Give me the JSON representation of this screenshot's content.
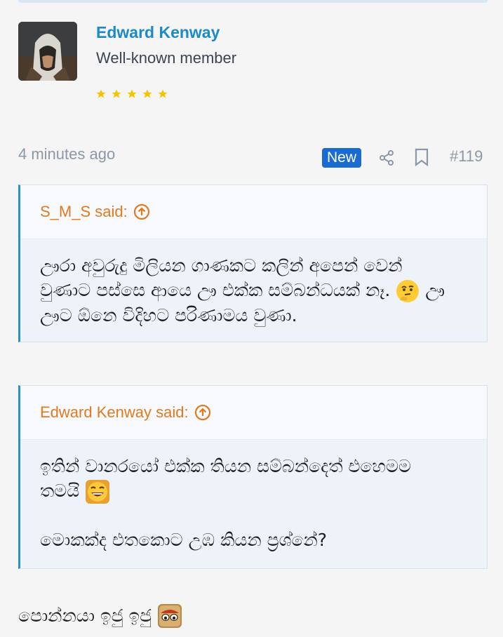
{
  "post": {
    "author": {
      "name": "Edward Kenway",
      "title": "Well-known member",
      "rating_stars": 5
    },
    "time": "4 minutes ago",
    "badge": "New",
    "number": "#119",
    "icons": {
      "share": "share-icon",
      "bookmark": "bookmark-icon",
      "quote_up": "arrow-up-circle-icon"
    },
    "quotes": [
      {
        "attribution": "S_M_S said:",
        "line1": "ඌරා අවුරුදු මිලියන ගාණකට කලින් අපෙන් වෙන්",
        "line2a": "වුණාට පස්සෙ ආයෙ ඌ එක්ක සම්බන්ධයක් නෑ.",
        "line2b": "ඌ",
        "line3": "ඌට ඕනෙ විදිහට පරිණාමය වුණා.",
        "emoji": "thinking-face-emoji"
      },
      {
        "attribution": "Edward Kenway said:",
        "line1": "ඉතින් වානරයෝ එක්ක තියන සම්බන්දෙත් එහෙමම",
        "line2": "තමයි",
        "line3": "මොකක්ද එතකොට උඹ කියන ප්‍රශ්නේ?",
        "emoji": "grinning-face-emoji"
      }
    ],
    "reply": {
      "text": "පොන්නයා ඉජු ඉජු",
      "emoji": "eyes-emoji"
    }
  },
  "colors": {
    "username": "#1a8ac8",
    "quote_attribution": "#e07a20",
    "quote_border": "#2a93c6",
    "badge": "#1a6bd1",
    "star": "#f5c400"
  }
}
